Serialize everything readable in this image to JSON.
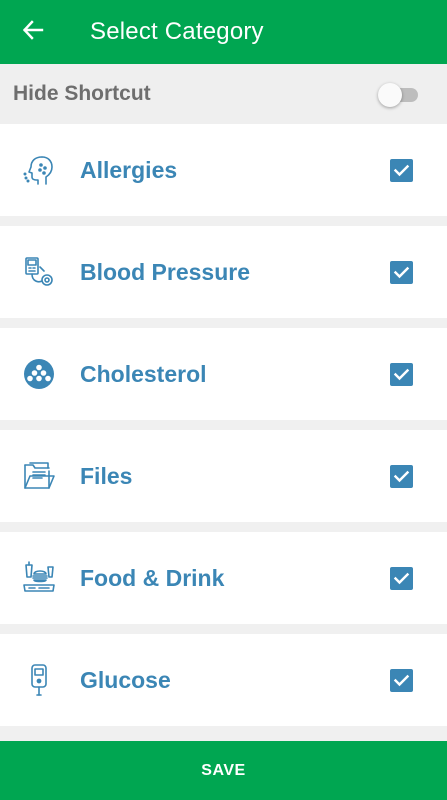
{
  "colors": {
    "primary": "#00a651",
    "accent": "#3b86b5",
    "shortcut_bg": "#efefef",
    "shortcut_text": "#6e6e6e"
  },
  "header": {
    "back_icon": "arrow-left-icon",
    "title": "Select Category"
  },
  "shortcut": {
    "label": "Hide Shortcut",
    "enabled": false
  },
  "categories": [
    {
      "label": "Allergies",
      "icon": "allergy-face-icon",
      "checked": true
    },
    {
      "label": "Blood Pressure",
      "icon": "blood-pressure-monitor-icon",
      "checked": true
    },
    {
      "label": "Cholesterol",
      "icon": "cholesterol-cells-icon",
      "checked": true
    },
    {
      "label": "Files",
      "icon": "folder-files-icon",
      "checked": true
    },
    {
      "label": "Food & Drink",
      "icon": "food-drink-icon",
      "checked": true
    },
    {
      "label": "Glucose",
      "icon": "glucose-meter-icon",
      "checked": true
    }
  ],
  "footer": {
    "save_label": "SAVE"
  }
}
